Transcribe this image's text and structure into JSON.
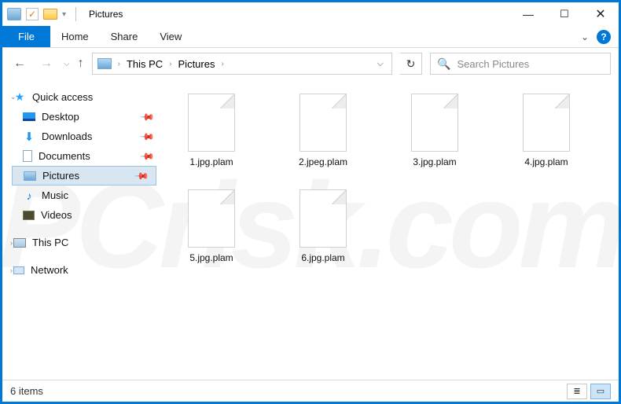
{
  "window": {
    "title": "Pictures",
    "count_label": "6 items"
  },
  "ribbon": {
    "file": "File",
    "tabs": [
      "Home",
      "Share",
      "View"
    ]
  },
  "breadcrumb": {
    "root": "This PC",
    "current": "Pictures"
  },
  "search": {
    "placeholder": "Search Pictures"
  },
  "sidebar": {
    "quick_access": "Quick access",
    "items": [
      {
        "label": "Desktop",
        "icon": "desk",
        "pinned": true
      },
      {
        "label": "Downloads",
        "icon": "dl",
        "pinned": true
      },
      {
        "label": "Documents",
        "icon": "doc",
        "pinned": true
      },
      {
        "label": "Pictures",
        "icon": "pic",
        "pinned": true,
        "selected": true
      },
      {
        "label": "Music",
        "icon": "mus",
        "pinned": false
      },
      {
        "label": "Videos",
        "icon": "vid",
        "pinned": false
      }
    ],
    "this_pc": "This PC",
    "network": "Network"
  },
  "files": [
    {
      "name": "1.jpg.plam"
    },
    {
      "name": "2.jpeg.plam"
    },
    {
      "name": "3.jpg.plam"
    },
    {
      "name": "4.jpg.plam"
    },
    {
      "name": "5.jpg.plam"
    },
    {
      "name": "6.jpg.plam"
    }
  ],
  "colors": {
    "accent": "#0078d7",
    "selection": "#d8e6f2"
  }
}
